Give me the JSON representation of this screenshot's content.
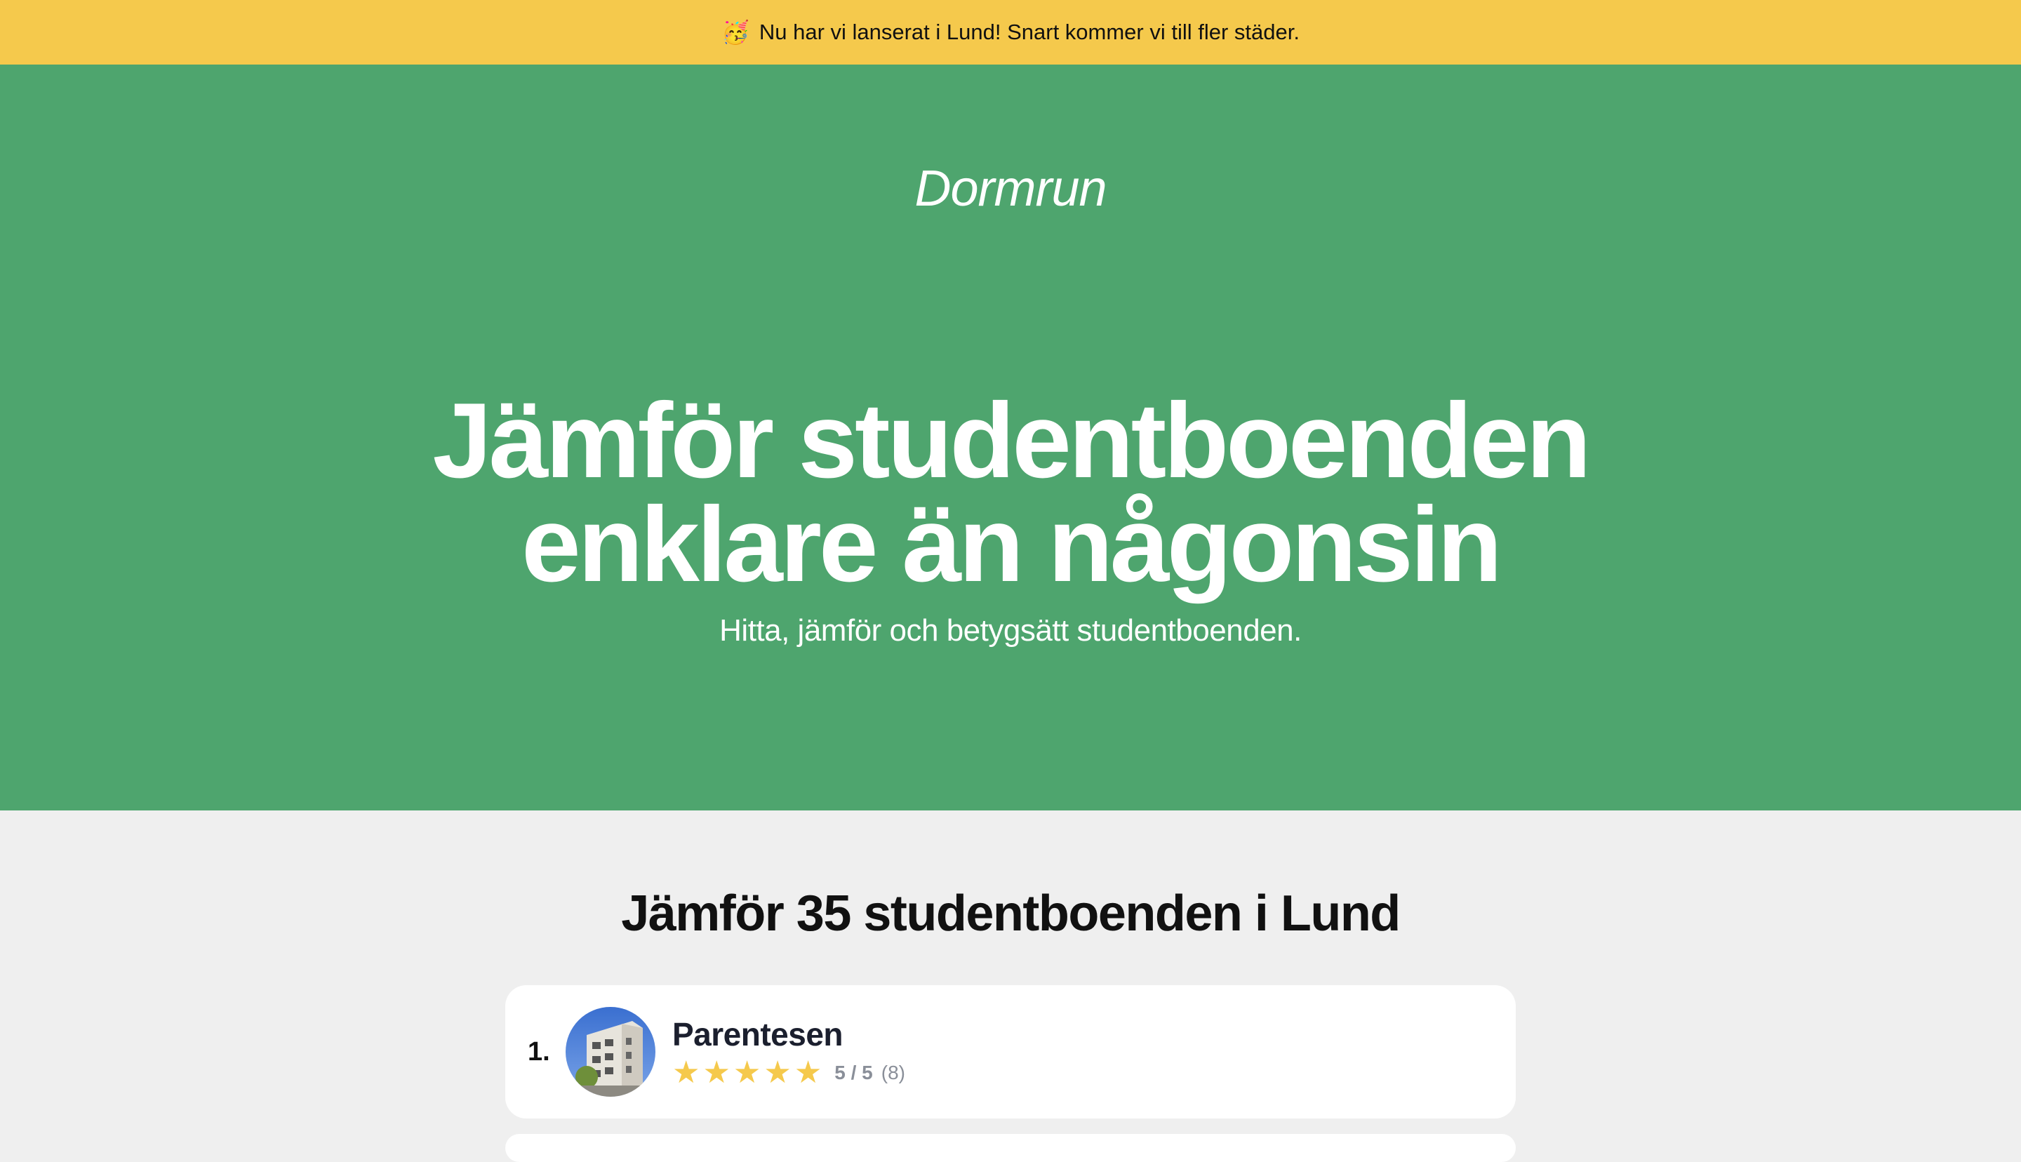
{
  "announcement": {
    "emoji": "🥳",
    "text": "Nu har vi lanserat i Lund! Snart kommer vi till fler städer."
  },
  "hero": {
    "logo": "Dormrun",
    "headline_line1": "Jämför studentboenden",
    "headline_line2": "enklare än någonsin",
    "subline": "Hitta, jämför och betygsätt studentboenden."
  },
  "section": {
    "title": "Jämför 35 studentboenden i Lund"
  },
  "listings": [
    {
      "rank": "1.",
      "name": "Parentesen",
      "stars": 5,
      "score": "5 / 5",
      "reviews": "(8)"
    }
  ],
  "colors": {
    "banner": "#f5c94c",
    "hero_green": "#4ea56e",
    "star": "#f5c94c"
  }
}
